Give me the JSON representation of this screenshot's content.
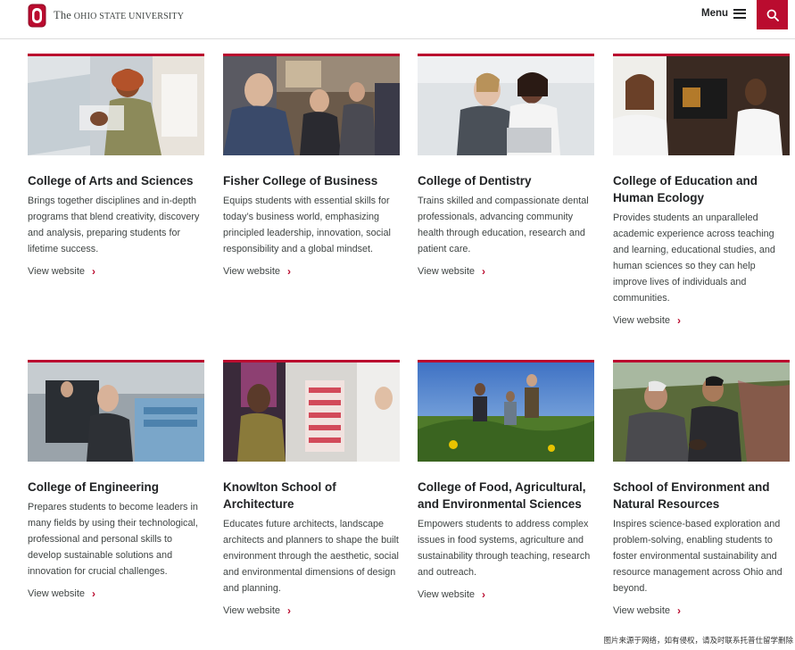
{
  "header": {
    "logo_text_prefix": "The",
    "logo_text_rest": " Ohio State University",
    "menu_label": "Menu",
    "brand_color": "#ba0c2f"
  },
  "colleges": [
    {
      "title": "College of Arts and Sciences",
      "description": "Brings together disciplines and in-depth programs that blend creativity, discovery and analysis, preparing students for lifetime success.",
      "link": "View website"
    },
    {
      "title": "Fisher College of Business",
      "description": "Equips students with essential skills for today’s business world, emphasizing principled leadership, innovation, social responsibility and a global mindset.",
      "link": "View website"
    },
    {
      "title": "College of Dentistry",
      "description": "Trains skilled and compassionate dental professionals, advancing community health through education, research and patient care.",
      "link": "View website"
    },
    {
      "title": "College of Education and Human Ecology",
      "description": "Provides students an unparalleled academic experience across teaching and learning, educational studies, and human sciences so they can help improve lives of individuals and communities.",
      "link": "View website"
    },
    {
      "title": "College of Engineering",
      "description": "Prepares students to become leaders in many fields by using their technological, professional and personal skills to develop sustainable solutions and innovation for crucial challenges.",
      "link": "View website"
    },
    {
      "title": "Knowlton School of Architecture",
      "description": "Educates future architects, landscape architects and planners to shape the built environment through the aesthetic, social and environmental dimensions of design and planning.",
      "link": "View website"
    },
    {
      "title": "College of Food, Agricultural, and Environmental Sciences",
      "description": "Empowers students to address complex issues in food systems, agriculture and sustainability through teaching, research and outreach.",
      "link": "View website"
    },
    {
      "title": "School of Environment and Natural Resources",
      "description": "Inspires science-based exploration and problem-solving, enabling students to foster environmental sustainability and resource management across Ohio and beyond.",
      "link": "View website"
    }
  ],
  "watermark": "图片来源于网络，如有侵权，请及时联系托普仕留学删除"
}
